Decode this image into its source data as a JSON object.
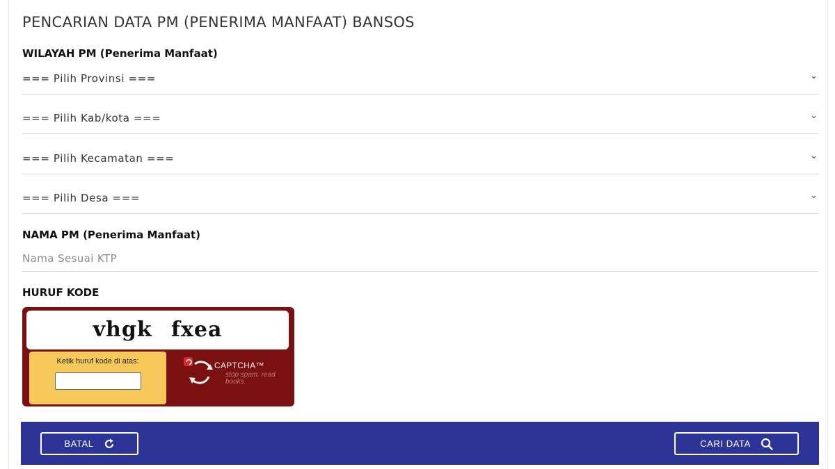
{
  "header": {
    "title": "PENCARIAN DATA PM (PENERIMA MANFAAT) BANSOS"
  },
  "wilayah": {
    "label": "WILAYAH PM (Penerima Manfaat)",
    "selects": [
      {
        "value": "=== Pilih Provinsi ==="
      },
      {
        "value": "=== Pilih Kab/kota ==="
      },
      {
        "value": "=== Pilih Kecamatan ==="
      },
      {
        "value": "=== Pilih Desa ==="
      }
    ]
  },
  "nama": {
    "label": "NAMA PM (Penerima Manfaat)",
    "placeholder": "Nama Sesuai KTP",
    "value": ""
  },
  "kode": {
    "label": "HURUF KODE",
    "captcha_word": "vhgk fxea",
    "entry_label": "Ketik huruf kode di atas:",
    "entry_value": "",
    "brand": "CAPTCHA™",
    "tagline": "stop spam. read books."
  },
  "actions": {
    "batal_label": "BATAL",
    "cari_label": "CARI DATA"
  },
  "colors": {
    "action_bar": "#2c3497",
    "captcha_frame": "#7a1010",
    "captcha_entry_bg": "#f7c95a"
  },
  "icons": {
    "select_chevron": "chevron-down-icon",
    "batal": "refresh-icon",
    "cari": "search-icon",
    "captcha_reload": "reload-arrows-icon"
  }
}
